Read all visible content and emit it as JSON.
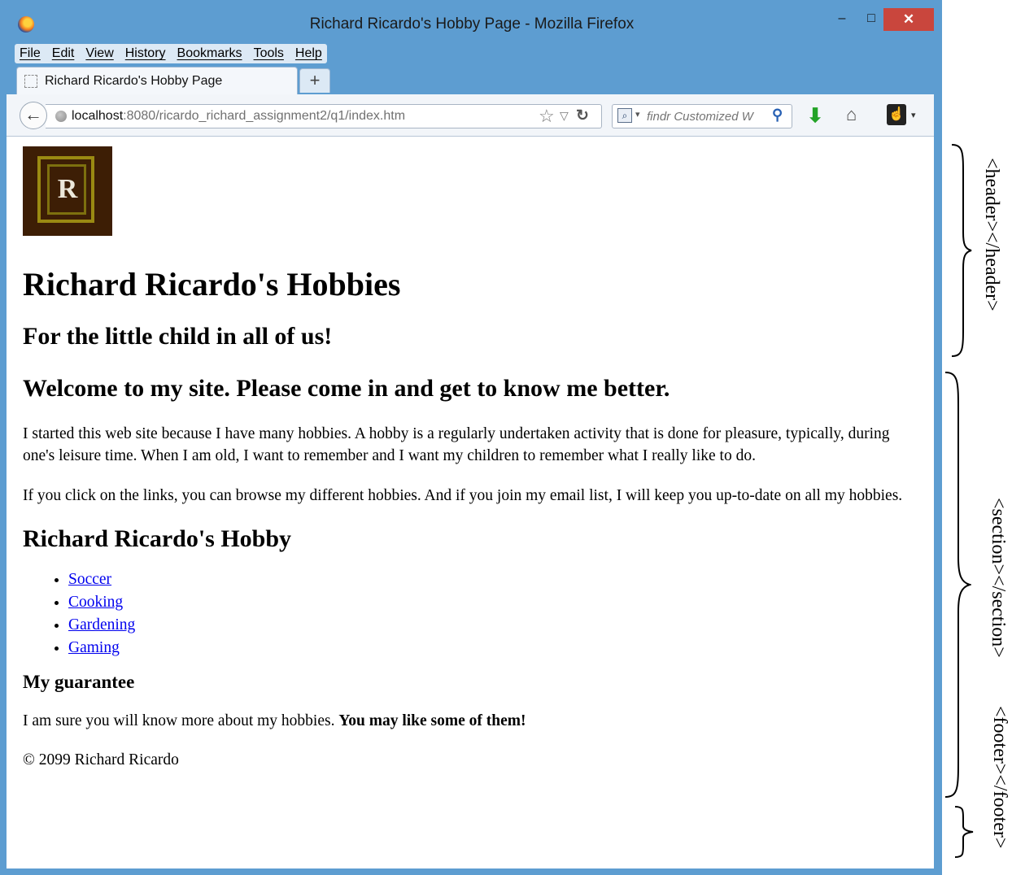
{
  "window": {
    "title": "Richard Ricardo's Hobby Page - Mozilla Firefox",
    "minimize_label": "–",
    "maximize_label": "□",
    "close_label": "✕"
  },
  "menu": {
    "items": [
      "File",
      "Edit",
      "View",
      "History",
      "Bookmarks",
      "Tools",
      "Help"
    ]
  },
  "tabs": {
    "active_label": "Richard Ricardo's Hobby Page",
    "new_tab_label": "+"
  },
  "navbar": {
    "url_host": "localhost",
    "url_path": ":8080/ricardo_richard_assignment2/q1/index.htm",
    "search_placeholder": "findr Customized W"
  },
  "page": {
    "logo_letter": "R",
    "title": "Richard Ricardo's Hobbies",
    "subtitle": "For the little child in all of us!",
    "welcome": "Welcome to my site. Please come in and get to know me better.",
    "paragraph1": "I started this web site because I have many hobbies. A hobby is a regularly undertaken activity that is done for pleasure, typically, during one's leisure time. When I am old, I want to remember and I want my children to remember what I really like to do.",
    "paragraph2": "If you click on the links, you can browse my different hobbies. And if you join my email list, I will keep you up-to-date on all my hobbies.",
    "hobby_heading": "Richard Ricardo's Hobby",
    "hobbies": [
      "Soccer",
      "Cooking",
      "Gardening",
      "Gaming"
    ],
    "guarantee_heading": "My guarantee",
    "guarantee_text": "I am sure you will know more about my hobbies. ",
    "guarantee_bold": "You may like some of them!",
    "copyright": "© 2099 Richard Ricardo"
  },
  "annotations": {
    "header": "<header></header>",
    "section": "<section></section>",
    "footer": "<footer></footer>"
  },
  "colors": {
    "window_frame": "#5d9dd1",
    "close_button": "#c9463d",
    "link": "#0000ee",
    "logo_bg": "#3d1e05"
  }
}
